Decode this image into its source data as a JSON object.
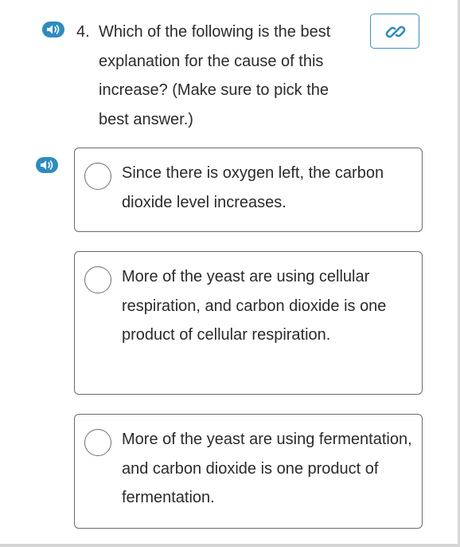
{
  "question": {
    "number": "4.",
    "text": "Which of the following is the best explanation for the cause of this increase? (Make sure to pick the best answer.)"
  },
  "icons": {
    "read_aloud": "speaker-icon",
    "link": "link-icon"
  },
  "colors": {
    "accent": "#3a8fc0",
    "border": "#6a6a6a"
  },
  "choices": [
    {
      "text": "Since there is oxygen left, the carbon dioxide level increases."
    },
    {
      "text": "More of the yeast are using cellular respiration, and carbon dioxide is one product of cellular respiration."
    },
    {
      "text": "More of the yeast are using fermentation, and carbon dioxide is one product of fermentation."
    }
  ]
}
